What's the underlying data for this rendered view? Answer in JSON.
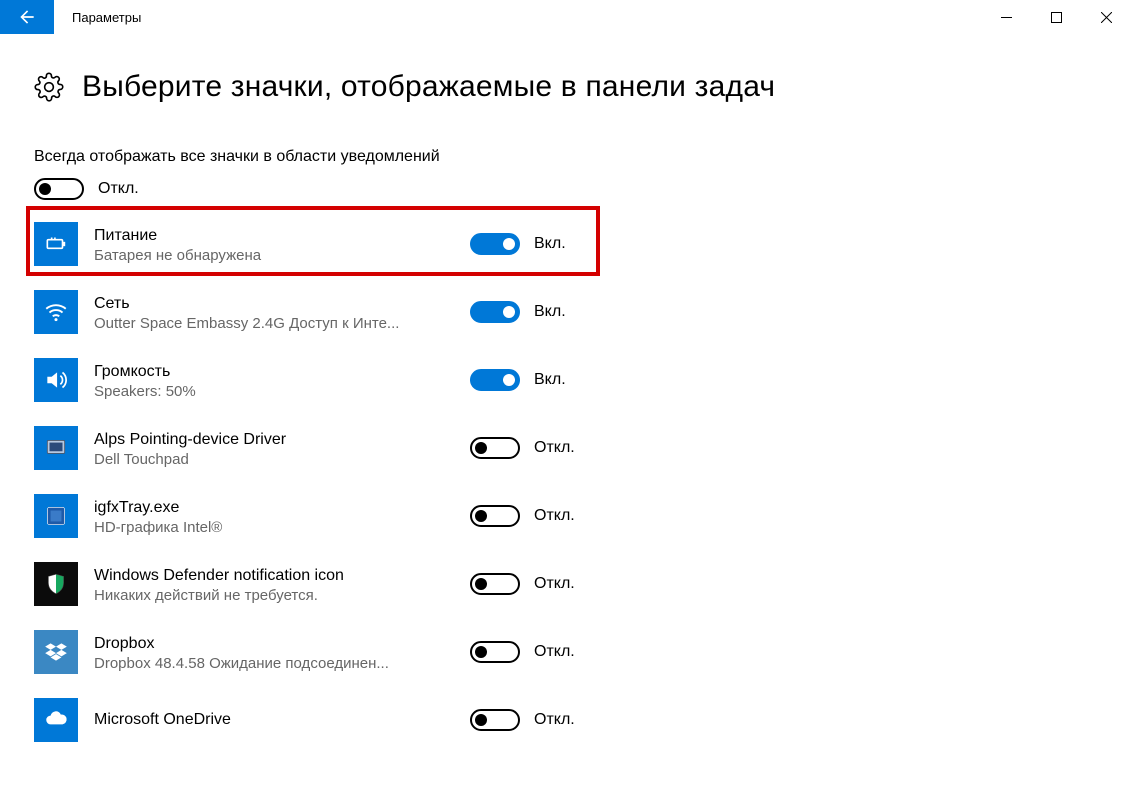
{
  "window": {
    "title": "Параметры"
  },
  "page": {
    "heading": "Выберите значки, отображаемые в панели задач",
    "always_show_label": "Всегда отображать все значки в области уведомлений",
    "master_toggle": {
      "state": "off",
      "label": "Откл."
    }
  },
  "labels": {
    "on": "Вкл.",
    "off": "Откл."
  },
  "items": [
    {
      "icon": "power-icon",
      "title": "Питание",
      "subtitle": "Батарея не обнаружена",
      "toggle": "on",
      "highlighted": true
    },
    {
      "icon": "wifi-icon",
      "title": "Сеть",
      "subtitle": "Outter Space Embassy 2.4G Доступ к Инте...",
      "toggle": "on"
    },
    {
      "icon": "volume-icon",
      "title": "Громкость",
      "subtitle": "Speakers: 50%",
      "toggle": "on"
    },
    {
      "icon": "touchpad-icon",
      "title": "Alps Pointing-device Driver",
      "subtitle": "Dell Touchpad",
      "toggle": "off"
    },
    {
      "icon": "intel-gfx-icon",
      "title": "igfxTray.exe",
      "subtitle": "HD-графика Intel®",
      "toggle": "off"
    },
    {
      "icon": "defender-icon",
      "title": "Windows Defender notification icon",
      "subtitle": "Никаких действий не требуется.",
      "toggle": "off"
    },
    {
      "icon": "dropbox-icon",
      "title": "Dropbox",
      "subtitle": "Dropbox 48.4.58 Ожидание подсоединен...",
      "toggle": "off"
    },
    {
      "icon": "onedrive-icon",
      "title": "Microsoft OneDrive",
      "subtitle": "",
      "toggle": "off"
    }
  ]
}
